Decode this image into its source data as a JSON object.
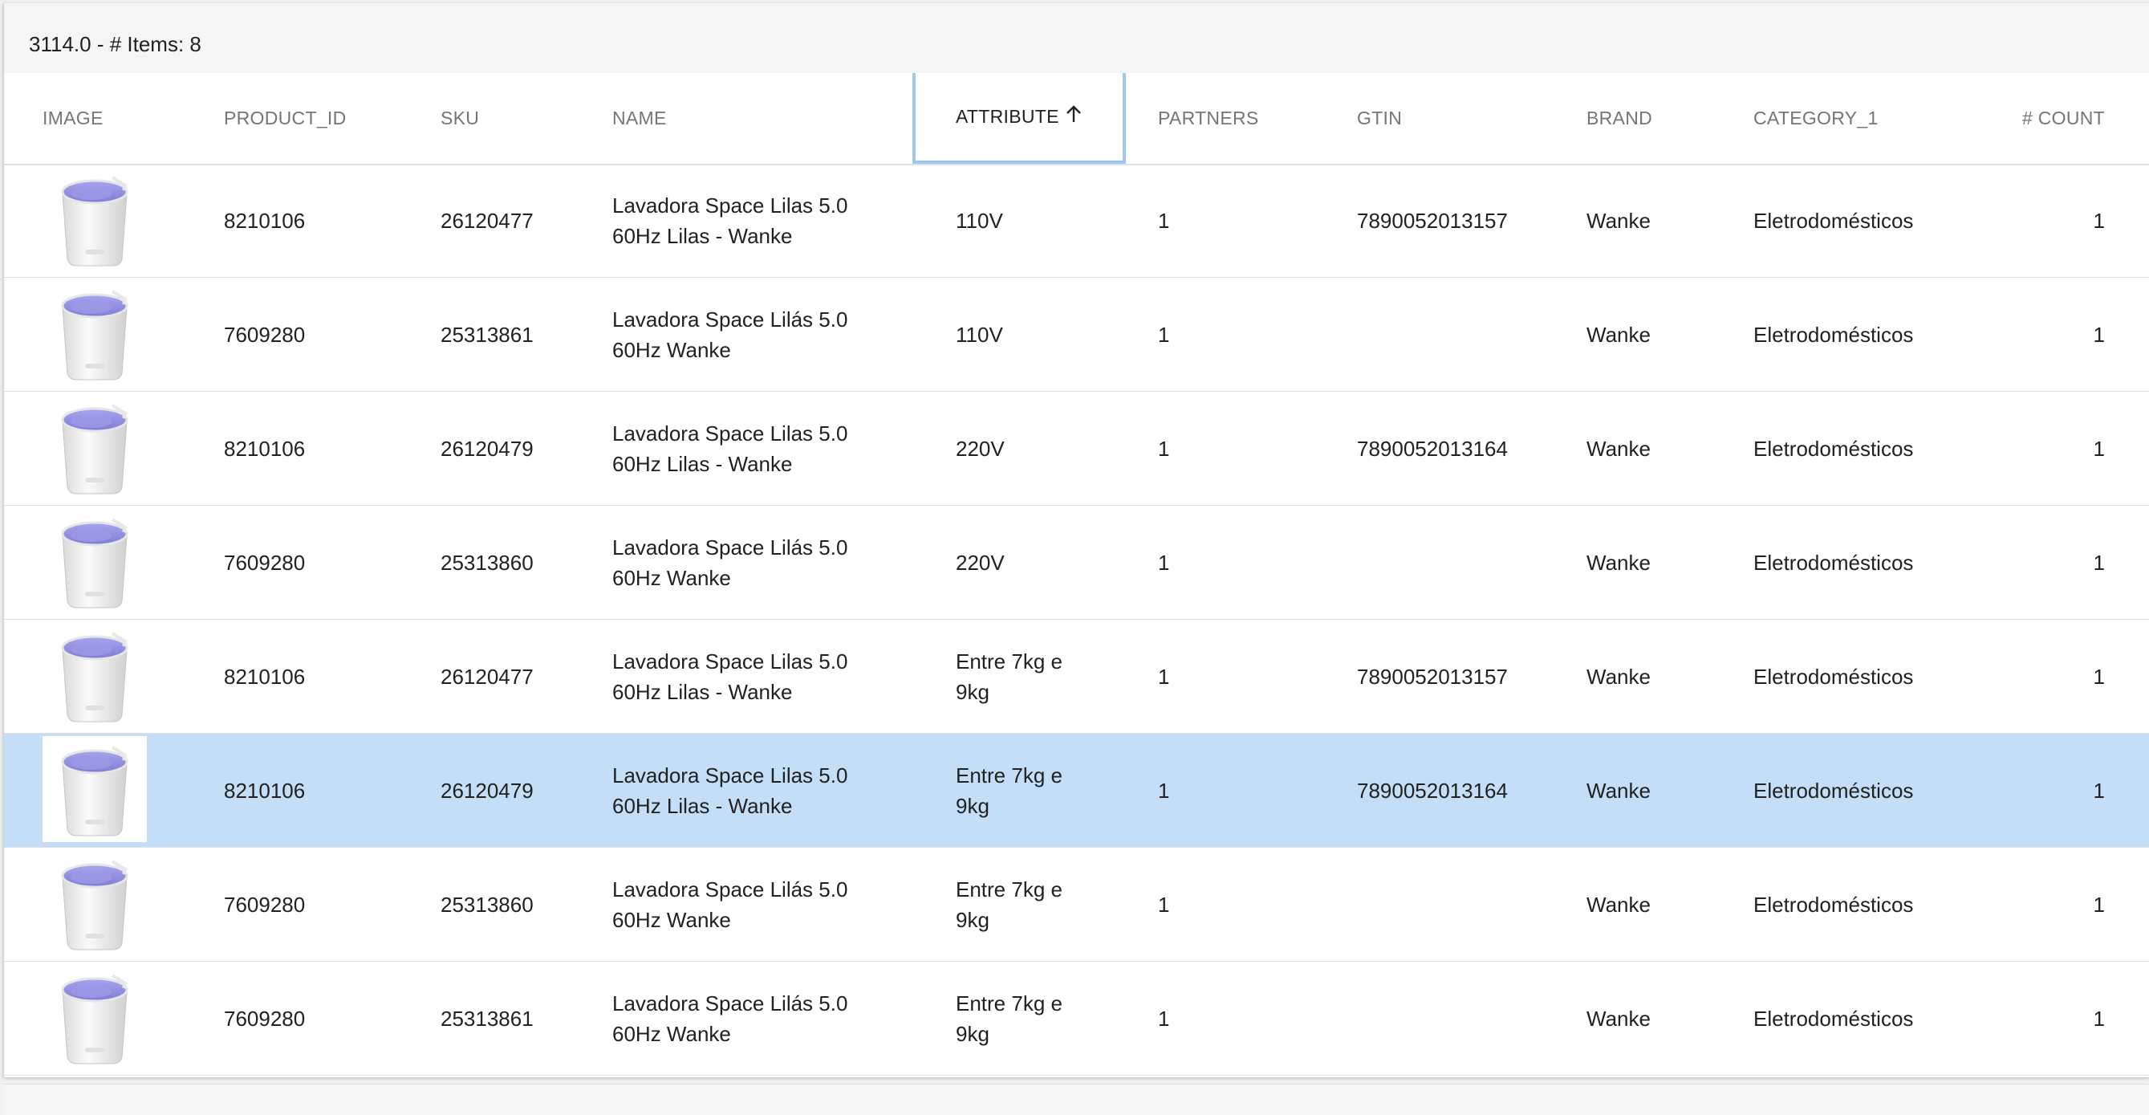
{
  "title": "3114.0 - # Items: 8",
  "columns": {
    "image": "IMAGE",
    "product_id": "PRODUCT_ID",
    "sku": "SKU",
    "name": "NAME",
    "attribute": "ATTRIBUTE",
    "partners": "PARTNERS",
    "gtin": "GTIN",
    "brand": "BRAND",
    "category": "CATEGORY_1",
    "count": "# COUNT"
  },
  "sort_icon": "arrow-up-icon",
  "colors": {
    "selected_row": "#c3def6",
    "sort_focus": "#9ec6f0",
    "washer_lid": "#8f8ee0"
  },
  "rows": [
    {
      "product_id": "8210106",
      "sku": "26120477",
      "name_line1": "Lavadora Space Lilas 5.0",
      "name_line2": "60Hz Lilas - Wanke",
      "attribute_line1": "110V",
      "attribute_line2": "",
      "partners": "1",
      "gtin": "7890052013157",
      "brand": "Wanke",
      "category": "Eletrodomésticos",
      "count": "1",
      "selected": false
    },
    {
      "product_id": "7609280",
      "sku": "25313861",
      "name_line1": "Lavadora Space Lilás 5.0",
      "name_line2": "60Hz Wanke",
      "attribute_line1": "110V",
      "attribute_line2": "",
      "partners": "1",
      "gtin": "",
      "brand": "Wanke",
      "category": "Eletrodomésticos",
      "count": "1",
      "selected": false
    },
    {
      "product_id": "8210106",
      "sku": "26120479",
      "name_line1": "Lavadora Space Lilas 5.0",
      "name_line2": "60Hz Lilas - Wanke",
      "attribute_line1": "220V",
      "attribute_line2": "",
      "partners": "1",
      "gtin": "7890052013164",
      "brand": "Wanke",
      "category": "Eletrodomésticos",
      "count": "1",
      "selected": false
    },
    {
      "product_id": "7609280",
      "sku": "25313860",
      "name_line1": "Lavadora Space Lilás 5.0",
      "name_line2": "60Hz Wanke",
      "attribute_line1": "220V",
      "attribute_line2": "",
      "partners": "1",
      "gtin": "",
      "brand": "Wanke",
      "category": "Eletrodomésticos",
      "count": "1",
      "selected": false
    },
    {
      "product_id": "8210106",
      "sku": "26120477",
      "name_line1": "Lavadora Space Lilas 5.0",
      "name_line2": "60Hz Lilas - Wanke",
      "attribute_line1": "Entre 7kg e",
      "attribute_line2": "9kg",
      "partners": "1",
      "gtin": "7890052013157",
      "brand": "Wanke",
      "category": "Eletrodomésticos",
      "count": "1",
      "selected": false
    },
    {
      "product_id": "8210106",
      "sku": "26120479",
      "name_line1": "Lavadora Space Lilas 5.0",
      "name_line2": "60Hz Lilas - Wanke",
      "attribute_line1": "Entre 7kg e",
      "attribute_line2": "9kg",
      "partners": "1",
      "gtin": "7890052013164",
      "brand": "Wanke",
      "category": "Eletrodomésticos",
      "count": "1",
      "selected": true
    },
    {
      "product_id": "7609280",
      "sku": "25313860",
      "name_line1": "Lavadora Space Lilás 5.0",
      "name_line2": "60Hz Wanke",
      "attribute_line1": "Entre 7kg e",
      "attribute_line2": "9kg",
      "partners": "1",
      "gtin": "",
      "brand": "Wanke",
      "category": "Eletrodomésticos",
      "count": "1",
      "selected": false
    },
    {
      "product_id": "7609280",
      "sku": "25313861",
      "name_line1": "Lavadora Space Lilás 5.0",
      "name_line2": "60Hz Wanke",
      "attribute_line1": "Entre 7kg e",
      "attribute_line2": "9kg",
      "partners": "1",
      "gtin": "",
      "brand": "Wanke",
      "category": "Eletrodomésticos",
      "count": "1",
      "selected": false
    }
  ]
}
